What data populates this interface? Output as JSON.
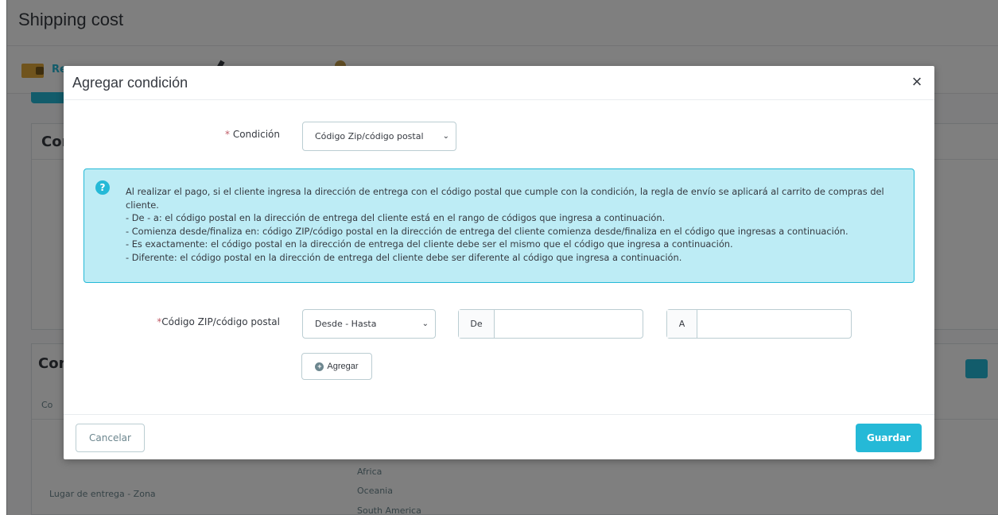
{
  "page": {
    "title": "Shipping cost",
    "tab_label": "Re",
    "card1_title": "Con",
    "card2_title": "Con",
    "card2_sub": "Co",
    "row_label": "Lugar de entrega - Zona",
    "regions": [
      "Africa",
      "Oceania",
      "South America"
    ]
  },
  "modal": {
    "title": "Agregar condición",
    "close": "×",
    "condition": {
      "required_mark": "*",
      "label": " Condición",
      "selected": "Código Zip/código postal"
    },
    "info": {
      "icon": "?",
      "lines": [
        "Al realizar el pago, si el cliente ingresa la dirección de entrega con el código postal que cumple con la condición, la regla de envío se aplicará al carrito de compras del cliente.",
        "- De - a: el código postal en la dirección de entrega del cliente está en el rango de códigos que ingresa a continuación.",
        "- Comienza desde/finaliza en: código ZIP/código postal en la dirección de entrega del cliente comienza desde/finaliza en el código que ingresas a continuación.",
        "- Es exactamente: el código postal en la dirección de entrega del cliente debe ser el mismo que el código que ingresa a continuación.",
        "- Diferente: el código postal en la dirección de entrega del cliente debe ser diferente al código que ingresa a continuación."
      ]
    },
    "zip": {
      "required_mark": "*",
      "label": "Código ZIP/código postal",
      "mode_selected": "Desde - Hasta",
      "from_addon": "De",
      "from_value": "",
      "to_addon": "A",
      "to_value": ""
    },
    "add_button": "Agregar",
    "cancel_button": "Cancelar",
    "save_button": "Guardar"
  },
  "colors": {
    "accent": "#25b9d7",
    "info_bg": "#bdecf5",
    "required": "#c05c67",
    "text": "#363a41"
  },
  "icons": {
    "close": "close-icon",
    "info": "question-circle-icon",
    "add": "plus-circle-icon",
    "chevron": "chevron-down-icon"
  }
}
